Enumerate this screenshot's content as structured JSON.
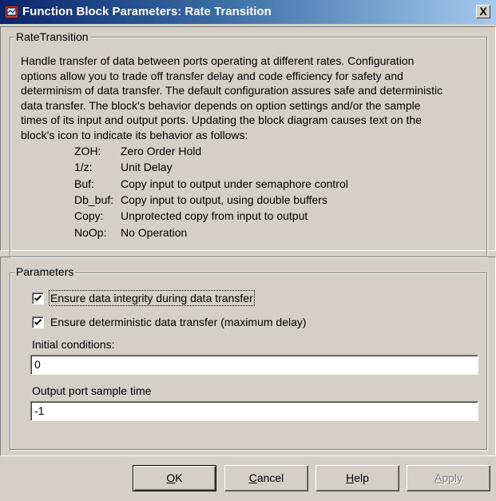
{
  "window": {
    "title": "Function Block Parameters: Rate Transition",
    "close_label": "X"
  },
  "description_group": {
    "legend": "RateTransition",
    "lines": [
      "Handle transfer of data between ports operating at different rates. Configuration",
      "options allow you to trade off transfer delay and code efficiency for safety and",
      "determinism of data transfer. The default configuration assures safe and deterministic",
      "data transfer. The block's behavior depends on option settings and/or the sample",
      "times of its input and output ports. Updating the block diagram causes text on the",
      "block's icon to indicate its behavior as follows:"
    ],
    "codes": [
      {
        "key": "ZOH:",
        "desc": "Zero Order Hold"
      },
      {
        "key": "1/z:",
        "desc": "Unit Delay"
      },
      {
        "key": "Buf:",
        "desc": "Copy input to output under semaphore control"
      },
      {
        "key": "Db_buf:",
        "desc": "Copy input to output, using double buffers"
      },
      {
        "key": "Copy:",
        "desc": "Unprotected copy from input to output"
      },
      {
        "key": "NoOp:",
        "desc": "No Operation"
      }
    ]
  },
  "parameters_group": {
    "legend": "Parameters",
    "data_integrity": {
      "label": "Ensure data integrity during data transfer",
      "checked": true
    },
    "deterministic": {
      "label": "Ensure deterministic data transfer (maximum delay)",
      "checked": true
    },
    "initial_conditions": {
      "label": "Initial conditions:",
      "value": "0"
    },
    "output_sample_time": {
      "label": "Output port sample time",
      "value": "-1"
    }
  },
  "buttons": {
    "ok": {
      "prefix": "",
      "accel": "O",
      "suffix": "K"
    },
    "cancel": {
      "prefix": "",
      "accel": "C",
      "suffix": "ancel"
    },
    "help": {
      "prefix": "",
      "accel": "H",
      "suffix": "elp"
    },
    "apply": {
      "prefix": "",
      "accel": "A",
      "suffix": "pply"
    }
  },
  "colors": {
    "titlebar_start": "#0a246a",
    "titlebar_end": "#a6caf0",
    "dialog_face": "#d4d0c8"
  }
}
